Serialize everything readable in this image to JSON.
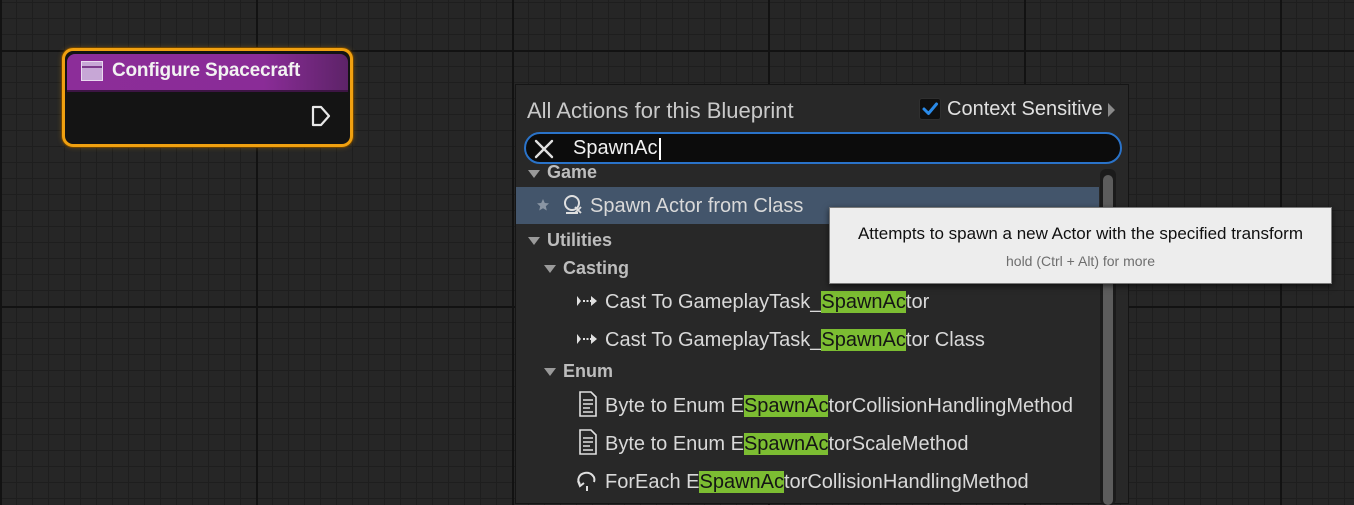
{
  "node": {
    "title": "Configure Spacecraft",
    "color": "#8c2d99",
    "border_color": "#f0a010",
    "icon": "event-icon",
    "pin": "exec-output-pin-icon"
  },
  "menu": {
    "title": "All Actions for this Blueprint",
    "context_sensitive_label": "Context Sensitive",
    "context_sensitive_checked": true,
    "search_value": "SpawnAc",
    "categories": [
      {
        "label": "Game",
        "items": [
          {
            "label": "Spawn Actor from Class",
            "icon": "spawn-actor-icon",
            "favorite_icon": "star-icon",
            "selected": true
          }
        ]
      },
      {
        "label": "Utilities",
        "subcategories": [
          {
            "label": "Casting",
            "items": [
              {
                "prefix": "Cast To GameplayTask_",
                "match": "SpawnAc",
                "suffix": "tor",
                "icon": "cast-icon"
              },
              {
                "prefix": "Cast To GameplayTask_",
                "match": "SpawnAc",
                "suffix": "tor Class",
                "icon": "cast-icon"
              }
            ]
          },
          {
            "label": "Enum",
            "items": [
              {
                "prefix": "Byte to Enum E",
                "match": "SpawnAc",
                "suffix": "torCollisionHandlingMethod",
                "icon": "function-icon"
              },
              {
                "prefix": "Byte to Enum E",
                "match": "SpawnAc",
                "suffix": "torScaleMethod",
                "icon": "function-icon"
              },
              {
                "prefix": "ForEach E",
                "match": "SpawnAc",
                "suffix": "torCollisionHandlingMethod",
                "icon": "foreach-loop-icon"
              }
            ]
          }
        ]
      }
    ],
    "highlight_color": "#7cbd32",
    "selection_color": "#43556b",
    "accent_color": "#2a73c9"
  },
  "tooltip": {
    "text": "Attempts to spawn a new Actor with the specified transform",
    "hint": "hold (Ctrl + Alt) for more"
  }
}
